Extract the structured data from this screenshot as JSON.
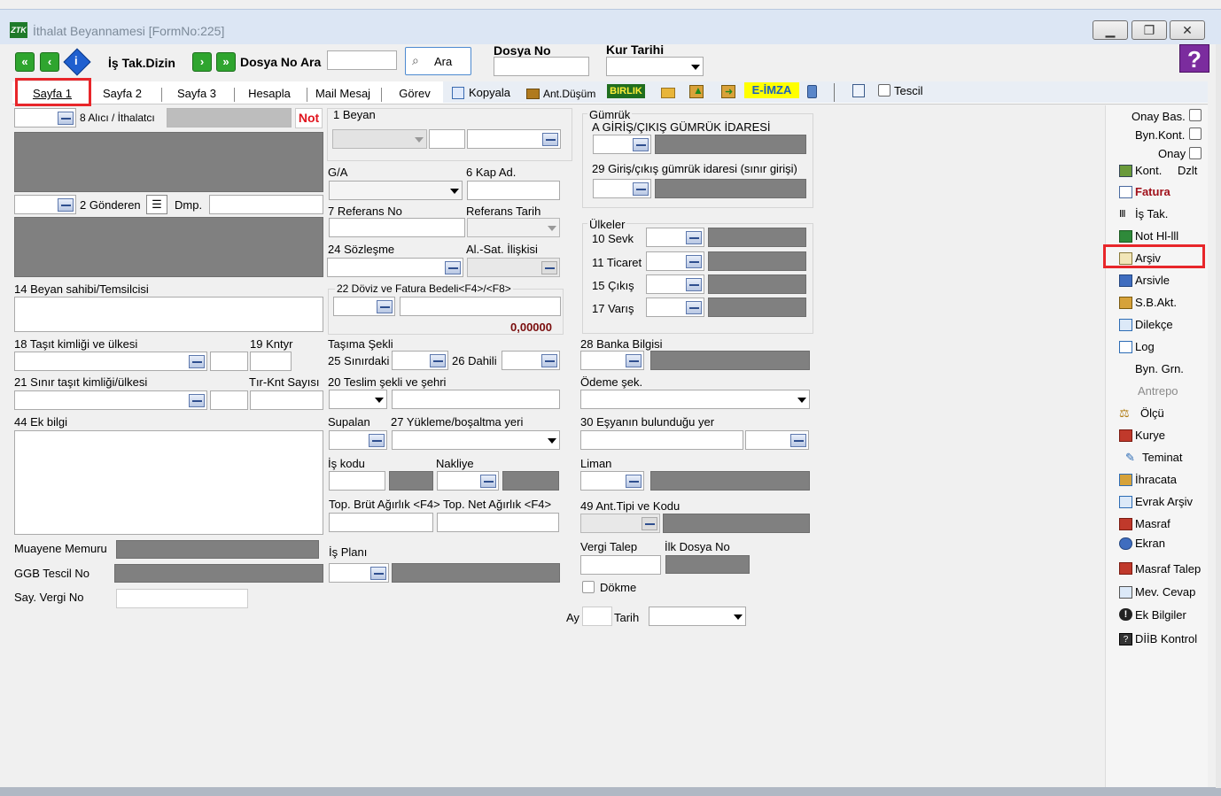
{
  "window": {
    "title": "İthalat Beyannamesi [FormNo:225]"
  },
  "toolbar": {
    "is_tak_dizin": "İş Tak.Dizin",
    "dosya_no_ara": "Dosya No Ara",
    "ara_button": "Ara",
    "dosya_no_label": "Dosya No",
    "kur_tarihi_label": "Kur Tarihi",
    "help": "?"
  },
  "tabs": [
    {
      "label": "Sayfa 1"
    },
    {
      "label": "Sayfa 2"
    },
    {
      "label": "Sayfa 3"
    },
    {
      "label": "Hesapla"
    },
    {
      "label": "Mail Mesaj"
    },
    {
      "label": "Görev"
    }
  ],
  "actions": {
    "kopyala": "Kopyala",
    "ant_dusum": "Ant.Düşüm",
    "birlik": "BIRLIK",
    "e_imza": "E-İMZA",
    "tescil": "Tescil"
  },
  "col1": {
    "alici": "8 Alıcı / İthalatcı",
    "not": "Not",
    "gonderen": "2 Gönderen",
    "dmp": "Dmp.",
    "beyan_sahibi": "14 Beyan sahibi/Temsilcisi",
    "tasit_kimligi": "18 Taşıt kimliği ve ülkesi",
    "kntyr": "19 Kntyr",
    "sinir_tasit": "21 Sınır taşıt kimliği/ülkesi",
    "tir_knt": "Tır-Knt Sayısı",
    "ek_bilgi": "44 Ek bilgi",
    "muayene": "Muayene Memuru",
    "ggb": "GGB Tescil No",
    "say_vergi": "Say. Vergi No"
  },
  "col2": {
    "beyan": "1 Beyan",
    "ga": "G/A",
    "kap_ad": "6 Kap Ad.",
    "referans_no": "7 Referans No",
    "referans_tarih": "Referans Tarih",
    "sozlesme": "24 Sözleşme",
    "al_sat": "Al.-Sat. İlişkisi",
    "doviz": "22 Döviz ve Fatura Bedeli<F4>/<F8>",
    "doviz_value": "0,00000",
    "tasima": "Taşıma Şekli",
    "sinirdaki": "25 Sınırdaki",
    "dahili": "26 Dahili",
    "teslim": "20 Teslim şekli ve şehri",
    "supalan": "Supalan",
    "yukleme": "27 Yükleme/boşaltma yeri",
    "is_kodu": "İş kodu",
    "nakliye": "Nakliye",
    "brut": "Top. Brüt Ağırlık <F4>",
    "net": "Top. Net Ağırlık <F4>",
    "is_plani": "İş Planı"
  },
  "col3": {
    "gumruk": "Gümrük",
    "a_giris": "A GİRİŞ/ÇIKIŞ GÜMRÜK İDARESİ",
    "giris29": "29 Giriş/çıkış gümrük idaresi (sınır girişi)",
    "ulkeler": "Ülkeler",
    "sevk": "10 Sevk",
    "ticaret": "11 Ticaret",
    "cikis": "15 Çıkış",
    "varis": "17 Varış",
    "banka": "28 Banka Bilgisi",
    "odeme": "Ödeme şek.",
    "esya": "30 Eşyanın bulunduğu yer",
    "liman": "Liman",
    "ant_tipi": "49 Ant.Tipi ve Kodu",
    "vergi_talep": "Vergi Talep",
    "ilk_dosya": "İlk Dosya No",
    "dokme": "Dökme",
    "ay": "Ay",
    "tarih": "Tarih"
  },
  "sidebar": {
    "onay_bas": "Onay Bas.",
    "byn_kont": "Byn.Kont.",
    "onay": "Onay",
    "kont": "Kont.",
    "dzlt": "Dzlt",
    "items": [
      "Fatura",
      "İş Tak.",
      "Not Hl-lll",
      "Arşiv",
      "Arsivle",
      "S.B.Akt.",
      "Dilekçe",
      "Log",
      "Byn. Grn.",
      "Antrepo",
      "Ölçü",
      "Kurye",
      "Teminat",
      "İhracata",
      "Evrak Arşiv",
      "Masraf",
      "Ekran",
      "Masraf Talep",
      "Mev. Cevap",
      "Ek Bilgiler",
      "DİİB Kontrol"
    ]
  }
}
